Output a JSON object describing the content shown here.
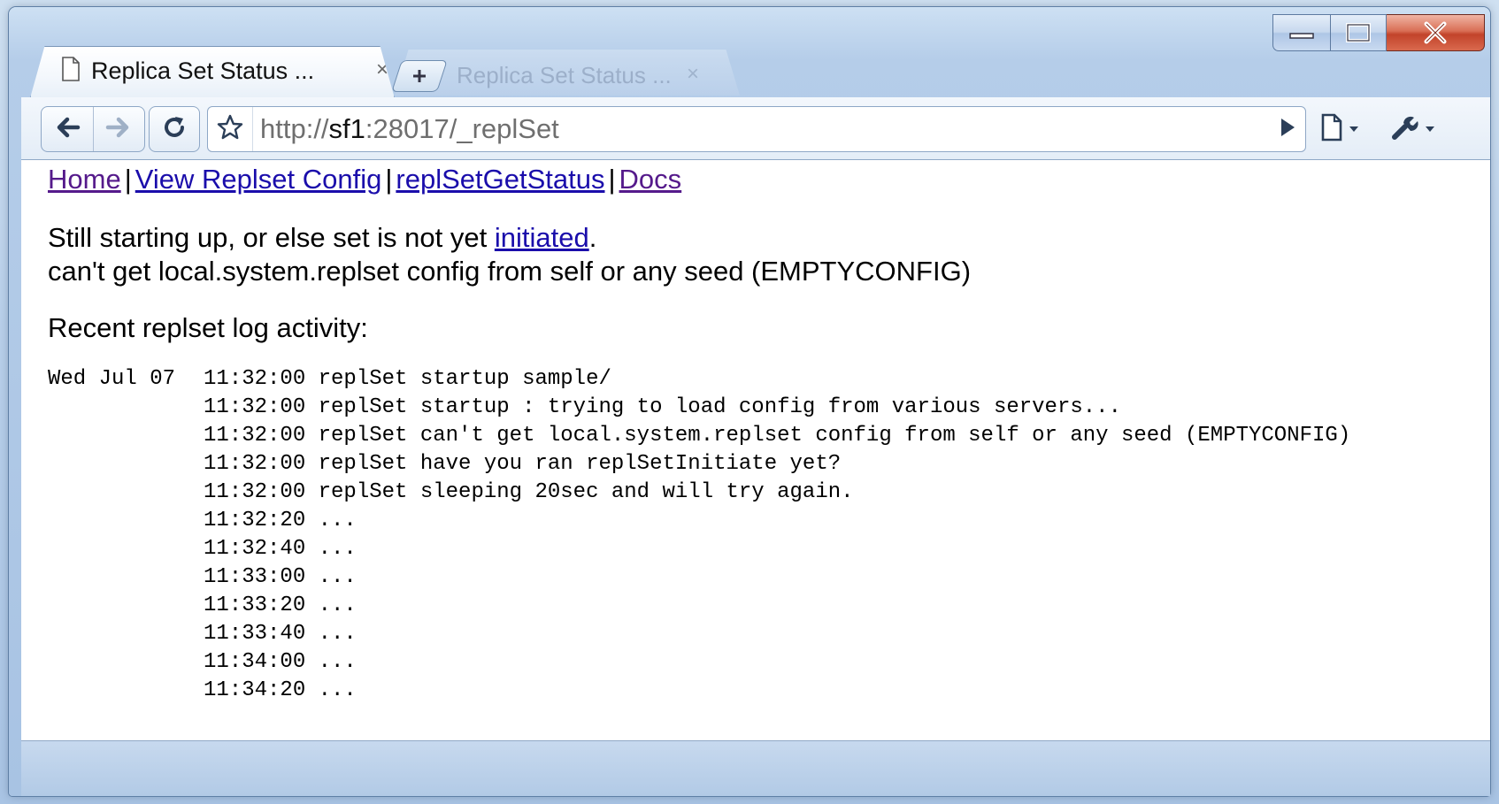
{
  "window": {
    "controls": {
      "minimize_icon": "minimize-icon",
      "maximize_icon": "maximize-icon",
      "close_icon": "close-icon"
    }
  },
  "tabs": [
    {
      "title": "Replica Set Status ...",
      "close": "×",
      "active": true
    }
  ],
  "background_tab": {
    "title": "Replica Set Status ...",
    "close": "×"
  },
  "toolbar": {
    "url_scheme": "http://",
    "url_host": "sf1",
    "url_rest": ":28017/_replSet"
  },
  "page": {
    "nav_links": [
      {
        "label": "Home",
        "visited": true
      },
      {
        "label": "View Replset Config",
        "visited": false
      },
      {
        "label": "replSetGetStatus",
        "visited": false
      },
      {
        "label": "Docs",
        "visited": true
      }
    ],
    "separator": "|",
    "status_line1_prefix": "Still starting up, or else set is not yet ",
    "status_line1_link": "initiated",
    "status_line1_suffix": ".",
    "status_line2": "can't get local.system.replset config from self or any seed (EMPTYCONFIG)",
    "recent_heading": "Recent replset log activity:",
    "log": [
      {
        "date": "Wed Jul 07",
        "time": "11:32:00",
        "message": "replSet startup sample/"
      },
      {
        "date": "",
        "time": "11:32:00",
        "message": "replSet startup : trying to load config from various servers..."
      },
      {
        "date": "",
        "time": "11:32:00",
        "message": "replSet can't get local.system.replset config from self or any seed (EMPTYCONFIG)"
      },
      {
        "date": "",
        "time": "11:32:00",
        "message": "replSet have you ran replSetInitiate yet?"
      },
      {
        "date": "",
        "time": "11:32:00",
        "message": "replSet sleeping 20sec and will try again."
      },
      {
        "date": "",
        "time": "11:32:20",
        "message": "..."
      },
      {
        "date": "",
        "time": "11:32:40",
        "message": "..."
      },
      {
        "date": "",
        "time": "11:33:00",
        "message": "..."
      },
      {
        "date": "",
        "time": "11:33:20",
        "message": "..."
      },
      {
        "date": "",
        "time": "11:33:40",
        "message": "..."
      },
      {
        "date": "",
        "time": "11:34:00",
        "message": "..."
      },
      {
        "date": "",
        "time": "11:34:20",
        "message": "..."
      }
    ]
  },
  "colors": {
    "link": "#1a0dab",
    "visited_link": "#551a8b",
    "close_button": "#c2432a",
    "frame": "#b5cde9"
  }
}
